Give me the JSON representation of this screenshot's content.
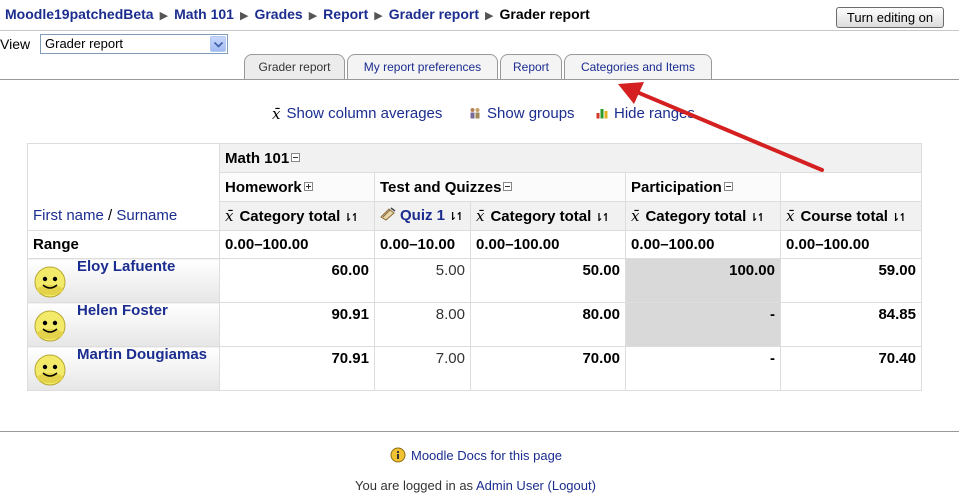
{
  "breadcrumb": [
    {
      "label": "Moodle19patchedBeta"
    },
    {
      "label": "Math 101"
    },
    {
      "label": "Grades"
    },
    {
      "label": "Report"
    },
    {
      "label": "Grader report"
    },
    {
      "label": "Grader report"
    }
  ],
  "separator": "▶",
  "turn_editing_label": "Turn editing on",
  "view": {
    "label": "View",
    "selected": "Grader report"
  },
  "tabs": [
    "Grader report",
    "My report preferences",
    "Report",
    "Categories and Items"
  ],
  "options": {
    "averages": "Show column averages",
    "groups": "Show groups",
    "ranges": "Hide ranges"
  },
  "table": {
    "course": "Math 101",
    "categories": {
      "homework": "Homework",
      "tests": "Test and Quizzes",
      "participation": "Participation"
    },
    "name_header": {
      "first": "First name",
      "slash": "/",
      "last": "Surname"
    },
    "columns": {
      "hw_total": "Category total",
      "quiz1": "Quiz 1",
      "tq_total": "Category total",
      "part_total": "Category total",
      "course_total": "Course total"
    },
    "range_label": "Range",
    "ranges": [
      "0.00–100.00",
      "0.00–10.00",
      "0.00–100.00",
      "0.00–100.00",
      "0.00–100.00"
    ],
    "students": [
      {
        "name": "Eloy Lafuente",
        "grades": [
          "60.00",
          "5.00",
          "50.00",
          "100.00",
          "59.00"
        ]
      },
      {
        "name": "Helen Foster",
        "grades": [
          "90.91",
          "8.00",
          "80.00",
          "-",
          "84.85"
        ]
      },
      {
        "name": "Martin Dougiamas",
        "grades": [
          "70.91",
          "7.00",
          "70.00",
          "-",
          "70.40"
        ]
      }
    ]
  },
  "footer": {
    "docs": "Moodle Docs for this page",
    "logged_prefix": "You are logged in as",
    "user": "Admin User",
    "logout": "(Logout)"
  },
  "colors": {
    "link": "#1b2d8f",
    "arrow": "#e01b1b",
    "shade": "#d9d9d9"
  }
}
